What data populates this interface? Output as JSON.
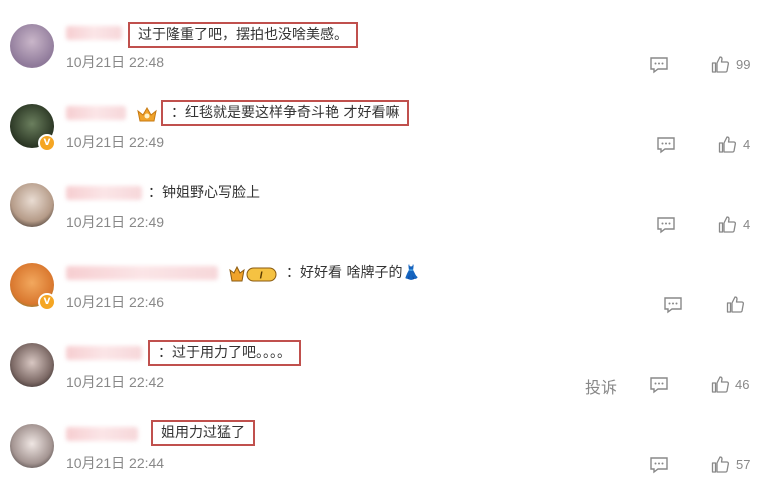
{
  "comments": [
    {
      "text": "过于隆重了吧，摆拍也没啥美感。",
      "time": "10月21日 22:48",
      "likes": "99",
      "boxed": true
    },
    {
      "text": "：红毯就是要这样争奇斗艳 才好看嘛",
      "time": "10月21日 22:49",
      "likes": "4",
      "boxed": true
    },
    {
      "text": "：钟姐野心写脸上",
      "time": "10月21日 22:49",
      "likes": "4",
      "boxed": false
    },
    {
      "text": "：好好看 啥牌子的👗",
      "time": "10月21日 22:46",
      "likes": "",
      "boxed": false
    },
    {
      "text": "：过于用力了吧。。。。",
      "time": "10月21日 22:42",
      "likes": "46",
      "boxed": true,
      "report": "投诉"
    },
    {
      "text": "姐用力过猛了",
      "time": "10月21日 22:44",
      "likes": "57",
      "boxed": true
    }
  ],
  "badges": {
    "level": "I",
    "verified": "V"
  },
  "colors": {
    "highlight_border": "#c0504d",
    "verified_badge": "#f5a623"
  }
}
